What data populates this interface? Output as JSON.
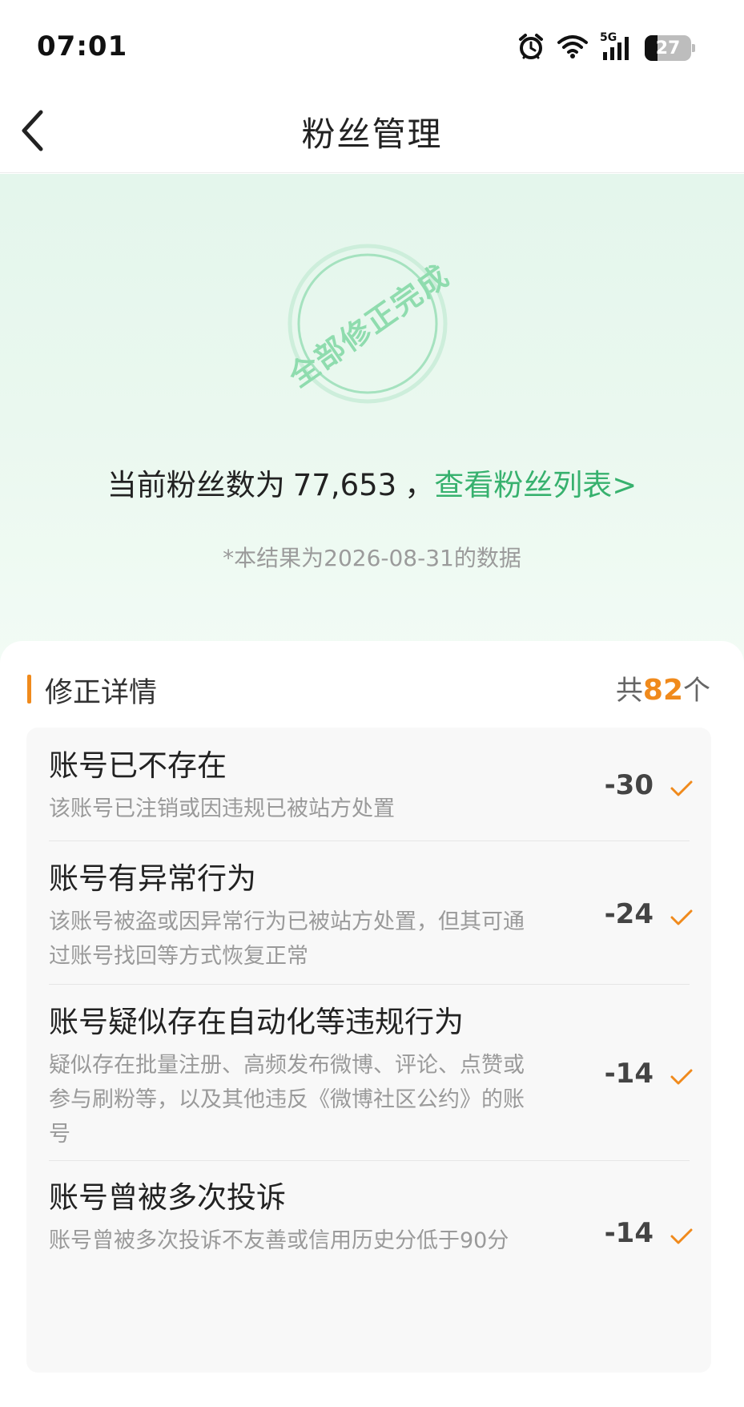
{
  "status_bar": {
    "time": "07:01",
    "network": "5G",
    "battery": "27",
    "icons": [
      "alarm-icon",
      "wifi-icon",
      "cellular-signal-icon",
      "battery-icon"
    ]
  },
  "nav": {
    "back_icon": "chevron-left-icon",
    "title": "粉丝管理"
  },
  "hero": {
    "stamp_text": "全部修正完成",
    "fans_prefix": "当前粉丝数为",
    "fans_count": "77,653",
    "separator": "，",
    "fans_link": "查看粉丝列表>",
    "note": "*本结果为2026-08-31的数据"
  },
  "details": {
    "title": "修正详情",
    "count_prefix": "共",
    "count_value": "82",
    "count_suffix": "个",
    "items": [
      {
        "title": "账号已不存在",
        "desc": "该账号已注销或因违规已被站方处置",
        "value": "-30"
      },
      {
        "title": "账号有异常行为",
        "desc": "该账号被盗或因异常行为已被站方处置，但其可通过账号找回等方式恢复正常",
        "value": "-24"
      },
      {
        "title": "账号疑似存在自动化等违规行为",
        "desc": "疑似存在批量注册、高频发布微博、评论、点赞或参与刷粉等，以及其他违反《微博社区公约》的账号",
        "value": "-14"
      },
      {
        "title": "账号曾被多次投诉",
        "desc": "账号曾被多次投诉不友善或信用历史分低于90分",
        "value": "-14"
      }
    ]
  },
  "colors": {
    "accent_green": "#37b16e",
    "accent_orange": "#f08a1c",
    "stamp_green": "#8fdcae"
  }
}
